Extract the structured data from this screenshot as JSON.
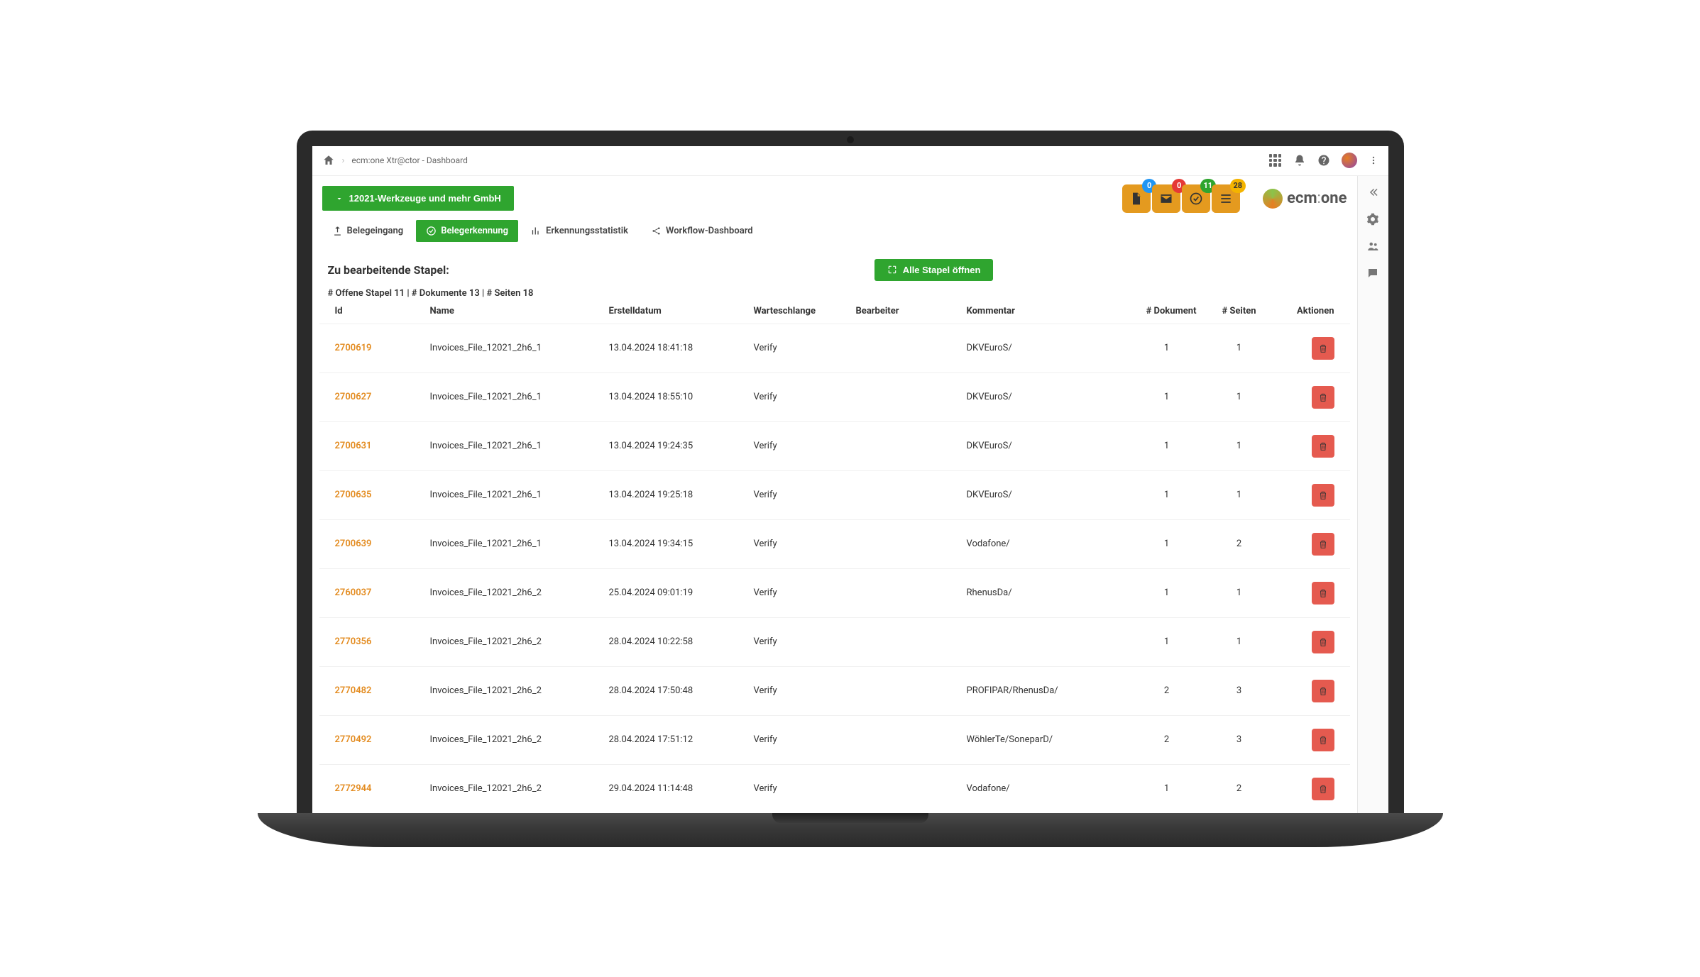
{
  "breadcrumb": "ecm:one Xtr@ctor - Dashboard",
  "company_button": "12021-Werkzeuge und mehr GmbH",
  "logo_text_a": "ecm",
  "logo_text_sep": ":",
  "logo_text_b": "one",
  "status_badges": {
    "docs": "0",
    "mail": "0",
    "check": "11",
    "list": "28"
  },
  "tabs": {
    "belegeingang": "Belegeingang",
    "belegerkennung": "Belegerkennung",
    "erkennungsstatistik": "Erkennungsstatistik",
    "workflow": "Workflow-Dashboard"
  },
  "section_title": "Zu bearbeitende Stapel:",
  "open_all_button": "Alle Stapel öffnen",
  "summary": "# Offene Stapel 11 | # Dokumente 13 | # Seiten 18",
  "columns": {
    "id": "Id",
    "name": "Name",
    "created": "Erstelldatum",
    "queue": "Warteschlange",
    "editor": "Bearbeiter",
    "comment": "Kommentar",
    "doc": "# Dokument",
    "pages": "# Seiten",
    "actions": "Aktionen"
  },
  "rows": [
    {
      "id": "2700619",
      "name": "Invoices_File_12021_2h6_1",
      "created": "13.04.2024 18:41:18",
      "queue": "Verify",
      "editor": "",
      "comment": "DKVEuroS/",
      "doc": "1",
      "pages": "1"
    },
    {
      "id": "2700627",
      "name": "Invoices_File_12021_2h6_1",
      "created": "13.04.2024 18:55:10",
      "queue": "Verify",
      "editor": "",
      "comment": "DKVEuroS/",
      "doc": "1",
      "pages": "1"
    },
    {
      "id": "2700631",
      "name": "Invoices_File_12021_2h6_1",
      "created": "13.04.2024 19:24:35",
      "queue": "Verify",
      "editor": "",
      "comment": "DKVEuroS/",
      "doc": "1",
      "pages": "1"
    },
    {
      "id": "2700635",
      "name": "Invoices_File_12021_2h6_1",
      "created": "13.04.2024 19:25:18",
      "queue": "Verify",
      "editor": "",
      "comment": "DKVEuroS/",
      "doc": "1",
      "pages": "1"
    },
    {
      "id": "2700639",
      "name": "Invoices_File_12021_2h6_1",
      "created": "13.04.2024 19:34:15",
      "queue": "Verify",
      "editor": "",
      "comment": "Vodafone/",
      "doc": "1",
      "pages": "2"
    },
    {
      "id": "2760037",
      "name": "Invoices_File_12021_2h6_2",
      "created": "25.04.2024 09:01:19",
      "queue": "Verify",
      "editor": "",
      "comment": "RhenusDa/",
      "doc": "1",
      "pages": "1"
    },
    {
      "id": "2770356",
      "name": "Invoices_File_12021_2h6_2",
      "created": "28.04.2024 10:22:58",
      "queue": "Verify",
      "editor": "",
      "comment": "",
      "doc": "1",
      "pages": "1"
    },
    {
      "id": "2770482",
      "name": "Invoices_File_12021_2h6_2",
      "created": "28.04.2024 17:50:48",
      "queue": "Verify",
      "editor": "",
      "comment": "PROFIPAR/RhenusDa/",
      "doc": "2",
      "pages": "3"
    },
    {
      "id": "2770492",
      "name": "Invoices_File_12021_2h6_2",
      "created": "28.04.2024 17:51:12",
      "queue": "Verify",
      "editor": "",
      "comment": "WöhlerTe/SoneparD/",
      "doc": "2",
      "pages": "3"
    },
    {
      "id": "2772944",
      "name": "Invoices_File_12021_2h6_2",
      "created": "29.04.2024 11:14:48",
      "queue": "Verify",
      "editor": "",
      "comment": "Vodafone/",
      "doc": "1",
      "pages": "2"
    }
  ]
}
